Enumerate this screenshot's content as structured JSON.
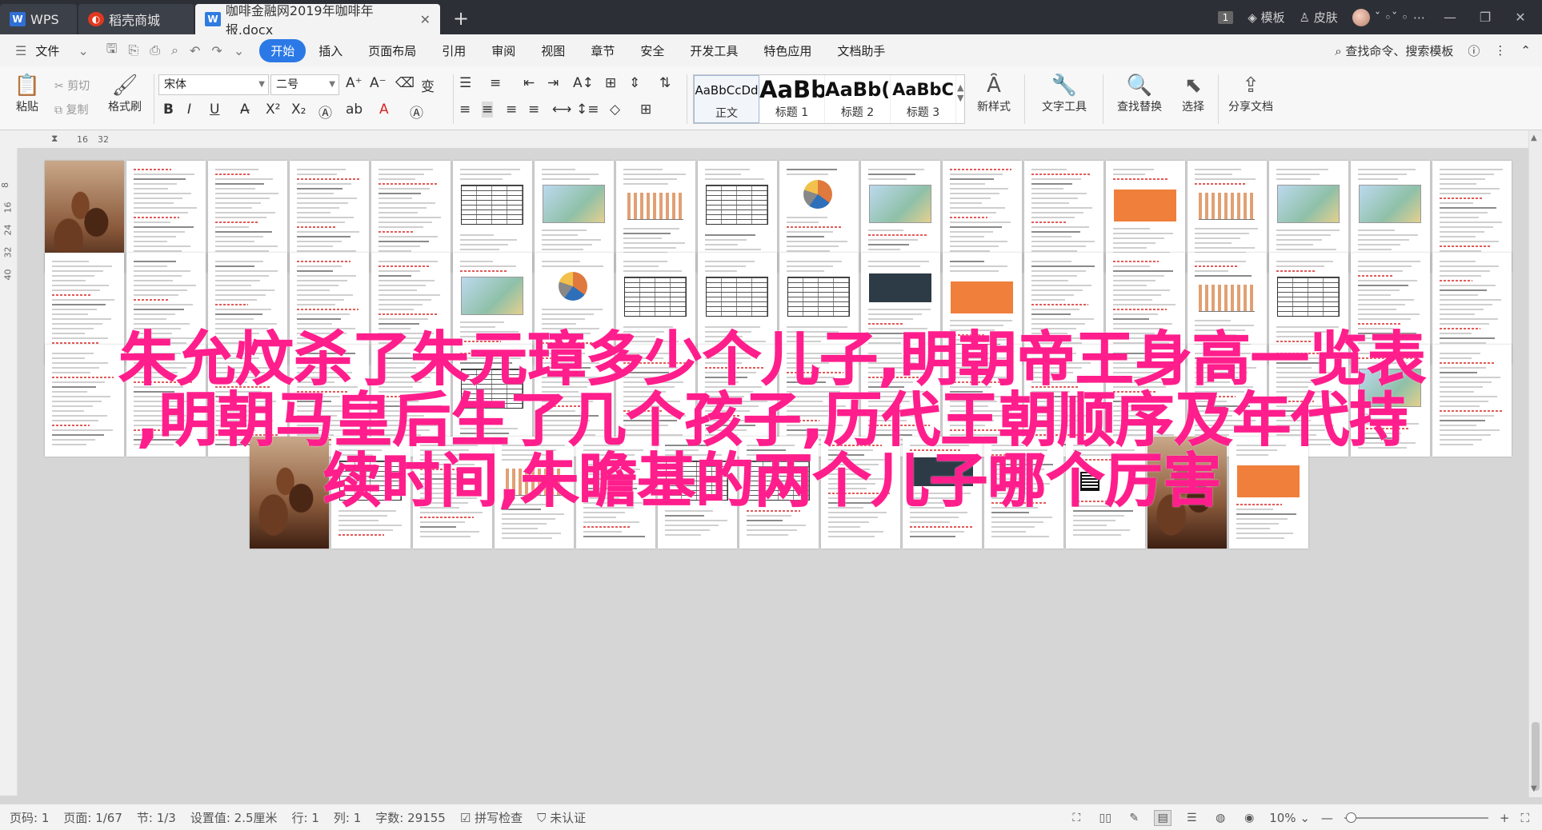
{
  "tabs": {
    "wps": "WPS",
    "store": "稻壳商城",
    "document": "咖啡金融网2019年咖啡年报.docx"
  },
  "titlebar": {
    "badge": "1",
    "template": "模板",
    "skin": "皮肤",
    "user_name": "ˇ ◦ˇ ◦"
  },
  "menu": {
    "file": "文件",
    "items": [
      "开始",
      "插入",
      "页面布局",
      "引用",
      "审阅",
      "视图",
      "章节",
      "安全",
      "开发工具",
      "特色应用",
      "文档助手"
    ],
    "active": "开始",
    "search": "查找命令、搜索模板"
  },
  "ribbon": {
    "paste": "粘贴",
    "cut": "剪切",
    "copy": "复制",
    "format_painter": "格式刷",
    "font_name": "宋体",
    "font_size": "二号",
    "styles": [
      {
        "preview": "AaBbCcDd",
        "label": "正文"
      },
      {
        "preview": "AaBb",
        "label": "标题 1"
      },
      {
        "preview": "AaBb(",
        "label": "标题 2"
      },
      {
        "preview": "AaBbC",
        "label": "标题 3"
      }
    ],
    "new_style": "新样式",
    "text_tools": "文字工具",
    "find_replace": "查找替换",
    "select": "选择",
    "share": "分享文档"
  },
  "ruler": {
    "marks": [
      "16",
      "32"
    ],
    "vmarks": [
      "8",
      "16",
      "24",
      "32",
      "40"
    ]
  },
  "overlay": {
    "line1": "朱允炆杀了朱元璋多少个儿子,明朝帝王身高一览表",
    "line2": ",明朝马皇后生了几个孩子,历代王朝顺序及年代持",
    "line3": "续时间,朱瞻基的两个儿子哪个厉害"
  },
  "status": {
    "page_num": "页码: 1",
    "pages": "页面: 1/67",
    "section": "节: 1/3",
    "setting": "设置值: 2.5厘米",
    "row": "行: 1",
    "col": "列: 1",
    "words": "字数: 29155",
    "spell": "拼写检查",
    "cert": "未认证",
    "zoom": "10%"
  }
}
